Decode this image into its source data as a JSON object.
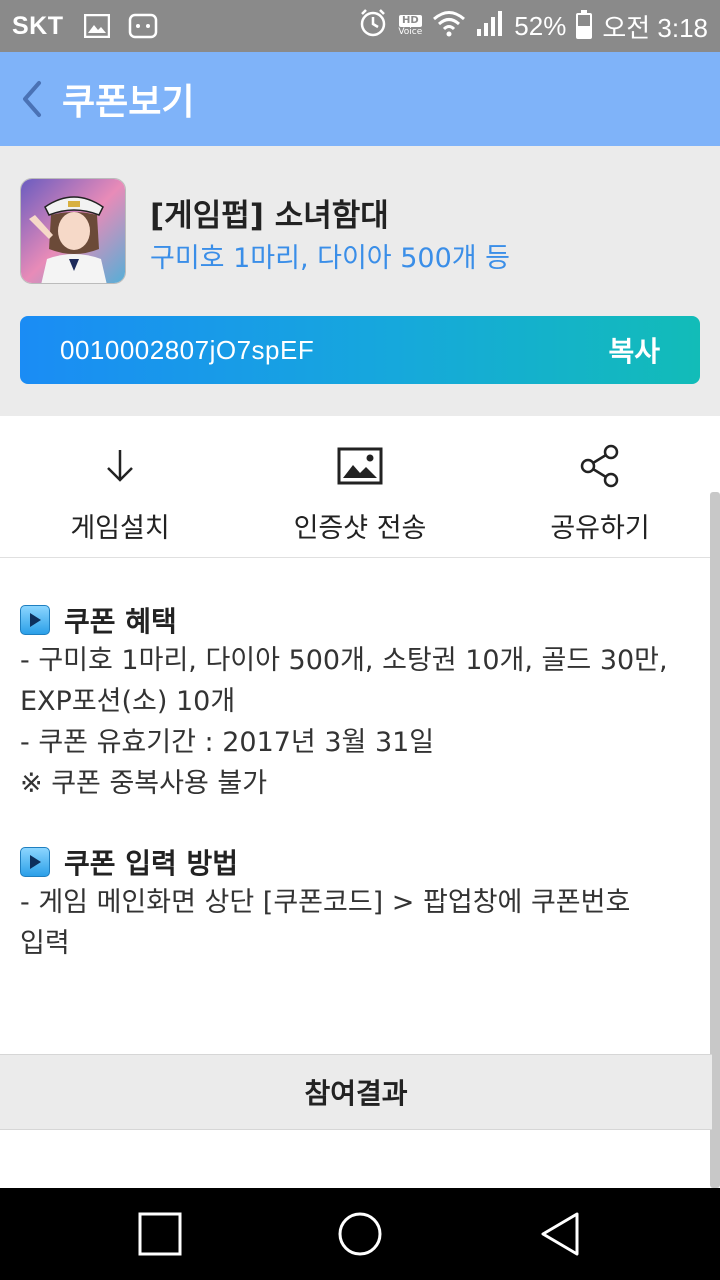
{
  "status_bar": {
    "carrier": "SKT",
    "hd_label": "HD",
    "hd_voice_label": "Voice",
    "battery_percent": "52%",
    "battery_level": 0.52,
    "time": "오전 3:18"
  },
  "header": {
    "title": "쿠폰보기",
    "back_icon": "chevron-left-icon",
    "background": "#7fb3f9"
  },
  "coupon": {
    "game_title": "[게임펍] 소녀함대",
    "reward_summary": "구미호 1마리, 다이아 500개 등",
    "code": "0010002807jO7spEF",
    "copy_label": "복사",
    "accent_color": "#3a8ee8"
  },
  "actions": [
    {
      "label": "게임설치",
      "icon": "download-icon"
    },
    {
      "label": "인증샷 전송",
      "icon": "image-icon"
    },
    {
      "label": "공유하기",
      "icon": "share-icon"
    }
  ],
  "benefits": {
    "title": "쿠폰 혜택",
    "lines": [
      "- 구미호 1마리, 다이아 500개, 소탕권 10개, 골드 30만,",
      "EXP포션(소) 10개",
      "- 쿠폰 유효기간 : 2017년 3월 31일",
      "※ 쿠폰 중복사용 불가"
    ]
  },
  "how_to": {
    "title": "쿠폰 입력 방법",
    "lines": [
      "- 게임 메인화면 상단 [쿠폰코드] > 팝업창에 쿠폰번호",
      "입력"
    ]
  },
  "result": {
    "label": "참여결과"
  },
  "nav": [
    "recent-apps-icon",
    "home-icon",
    "back-icon"
  ]
}
